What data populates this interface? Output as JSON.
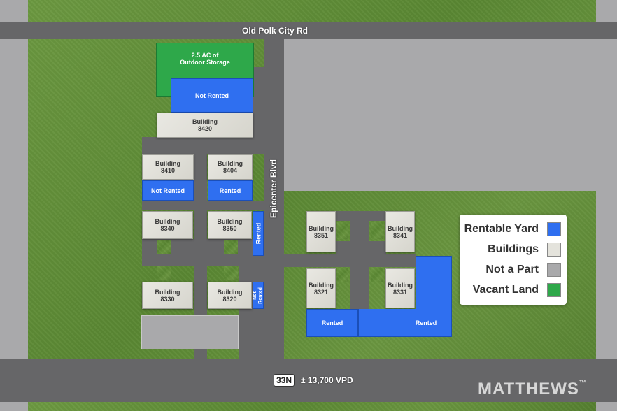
{
  "roads": {
    "north": "Old Polk City Rd",
    "center": "Epicenter Blvd",
    "south_shield": "33N",
    "south_traffic": "± 13,700 VPD"
  },
  "parcels": {
    "storage": "2.5 AC of\nOutdoor Storage",
    "yard_8420": "Not Rented",
    "b8420": "Building\n8420",
    "b8410": "Building\n8410",
    "yard_8410": "Not Rented",
    "b8404": "Building\n8404",
    "yard_8404": "Rented",
    "b8340": "Building\n8340",
    "b8350": "Building\n8350",
    "yard_8350": "Rented",
    "b8330": "Building\n8330",
    "b8320": "Building\n8320",
    "yard_8320": "Not\nRented",
    "b8351": "Building\n8351",
    "b8341": "Building\n8341",
    "b8321": "Building\n8321",
    "b8331": "Building\n8331",
    "yard_8321": "Rented",
    "yard_8331": "Rented"
  },
  "legend": {
    "items": [
      {
        "label": "Rentable Yard",
        "color": "#2f6ff0"
      },
      {
        "label": "Buildings",
        "color": "#e4e3dc"
      },
      {
        "label": "Not a Part",
        "color": "#a9a9ab"
      },
      {
        "label": "Vacant Land",
        "color": "#2ea84a"
      }
    ]
  },
  "brand": {
    "name": "MATTHEWS",
    "mark": "™"
  }
}
